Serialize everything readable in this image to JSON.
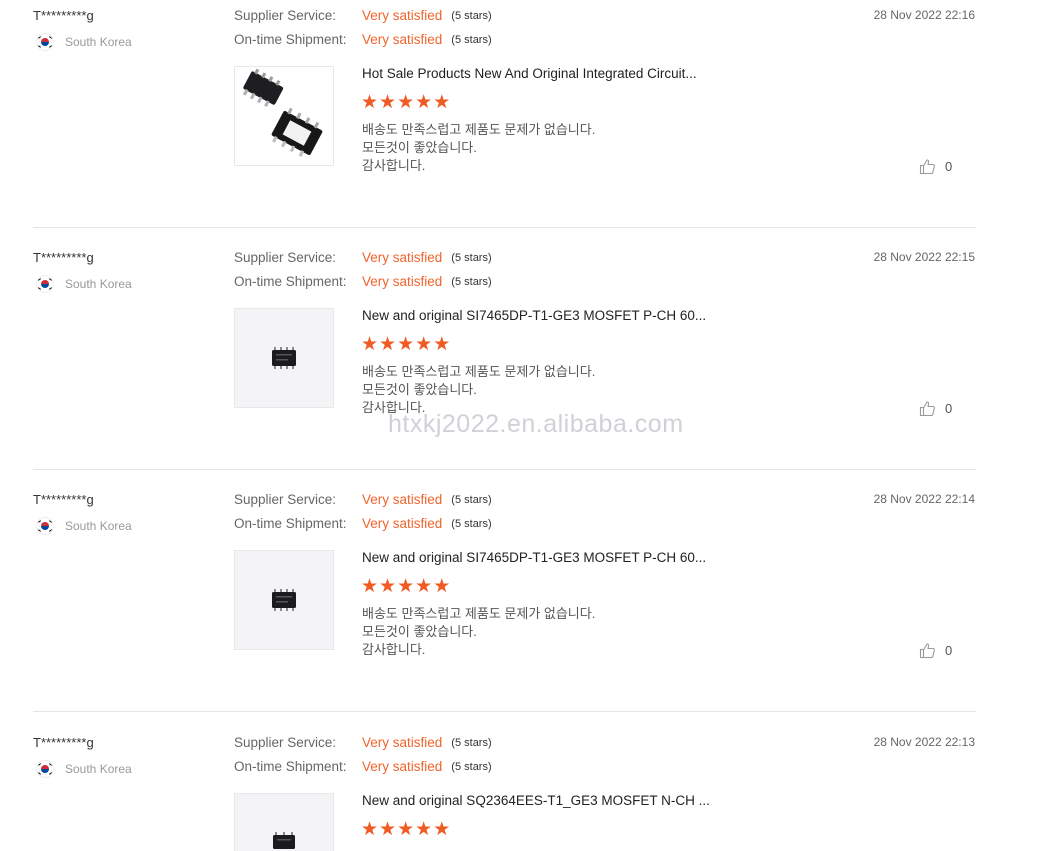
{
  "reviews": [
    {
      "user": "T*********g",
      "country": "South Korea",
      "supplier_service_label": "Supplier Service:",
      "supplier_service_value": "Very satisfied",
      "supplier_service_stars": "(5 stars)",
      "shipment_label": "On-time Shipment:",
      "shipment_value": "Very satisfied",
      "shipment_stars": "(5 stars)",
      "date": "28 Nov 2022 22:16",
      "product_title": "Hot Sale Products New And Original Integrated Circuit...",
      "product_image_icon": "msop-chip-image",
      "rating": 5,
      "text_line1": "배송도 만족스럽고 제품도 문제가 없습니다.",
      "text_line2": "모든것이 좋았습니다.",
      "text_line3": "감사합니다.",
      "likes": "0"
    },
    {
      "user": "T*********g",
      "country": "South Korea",
      "supplier_service_label": "Supplier Service:",
      "supplier_service_value": "Very satisfied",
      "supplier_service_stars": "(5 stars)",
      "shipment_label": "On-time Shipment:",
      "shipment_value": "Very satisfied",
      "shipment_stars": "(5 stars)",
      "date": "28 Nov 2022 22:15",
      "product_title": "New and original SI7465DP-T1-GE3 MOSFET P-CH 60...",
      "product_image_icon": "small-chip-image",
      "rating": 5,
      "text_line1": "배송도 만족스럽고 제품도 문제가 없습니다.",
      "text_line2": "모든것이 좋았습니다.",
      "text_line3": "감사합니다.",
      "likes": "0"
    },
    {
      "user": "T*********g",
      "country": "South Korea",
      "supplier_service_label": "Supplier Service:",
      "supplier_service_value": "Very satisfied",
      "supplier_service_stars": "(5 stars)",
      "shipment_label": "On-time Shipment:",
      "shipment_value": "Very satisfied",
      "shipment_stars": "(5 stars)",
      "date": "28 Nov 2022 22:14",
      "product_title": "New and original SI7465DP-T1-GE3 MOSFET P-CH 60...",
      "product_image_icon": "small-chip-image",
      "rating": 5,
      "text_line1": "배송도 만족스럽고 제품도 문제가 없습니다.",
      "text_line2": "모든것이 좋았습니다.",
      "text_line3": "감사합니다.",
      "likes": "0"
    },
    {
      "user": "T*********g",
      "country": "South Korea",
      "supplier_service_label": "Supplier Service:",
      "supplier_service_value": "Very satisfied",
      "supplier_service_stars": "(5 stars)",
      "shipment_label": "On-time Shipment:",
      "shipment_value": "Very satisfied",
      "shipment_stars": "(5 stars)",
      "date": "28 Nov 2022 22:13",
      "product_title": "New and original SQ2364EES-T1_GE3 MOSFET N-CH ...",
      "product_image_icon": "small-chip-image",
      "rating": 5,
      "text_line1": "",
      "text_line2": "",
      "text_line3": "",
      "likes": ""
    }
  ],
  "watermark": "htxkj2022.en.alibaba.com",
  "colors": {
    "accent": "#f0642c",
    "star": "#f05a23",
    "divider": "#e5e5e5"
  }
}
